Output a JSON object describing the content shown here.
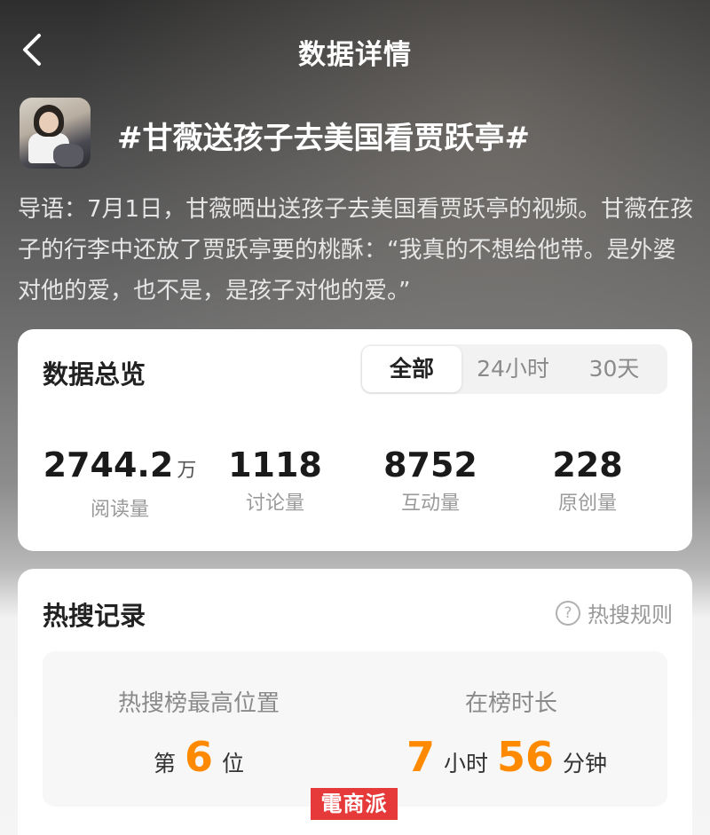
{
  "nav": {
    "title": "数据详情"
  },
  "topic": {
    "title": "#甘薇送孩子去美国看贾跃亭#"
  },
  "intro": "导语：7月1日，甘薇晒出送孩子去美国看贾跃亭的视频。甘薇在孩子的行李中还放了贾跃亭要的桃酥：“我真的不想给他带。是外婆对他的爱，也不是，是孩子对他的爱。”",
  "overview": {
    "title": "数据总览",
    "tabs": [
      {
        "label": "全部",
        "active": true
      },
      {
        "label": "24小时",
        "active": false
      },
      {
        "label": "30天",
        "active": false
      }
    ],
    "stats": [
      {
        "value": "2744.2",
        "unit": "万",
        "label": "阅读量"
      },
      {
        "value": "1118",
        "unit": "",
        "label": "讨论量"
      },
      {
        "value": "8752",
        "unit": "",
        "label": "互动量"
      },
      {
        "value": "228",
        "unit": "",
        "label": "原创量"
      }
    ]
  },
  "hot_search": {
    "title": "热搜记录",
    "rules_label": "热搜规则",
    "help_glyph": "?",
    "highest": {
      "label": "热搜榜最高位置",
      "prefix": "第",
      "value": "6",
      "suffix": "位"
    },
    "duration": {
      "label": "在榜时长",
      "hours": "7",
      "hours_unit": "小时",
      "minutes": "56",
      "minutes_unit": "分钟"
    }
  },
  "watermark": "電商派",
  "colors": {
    "accent": "#ff8a00",
    "watermark": "#e63a3a"
  }
}
